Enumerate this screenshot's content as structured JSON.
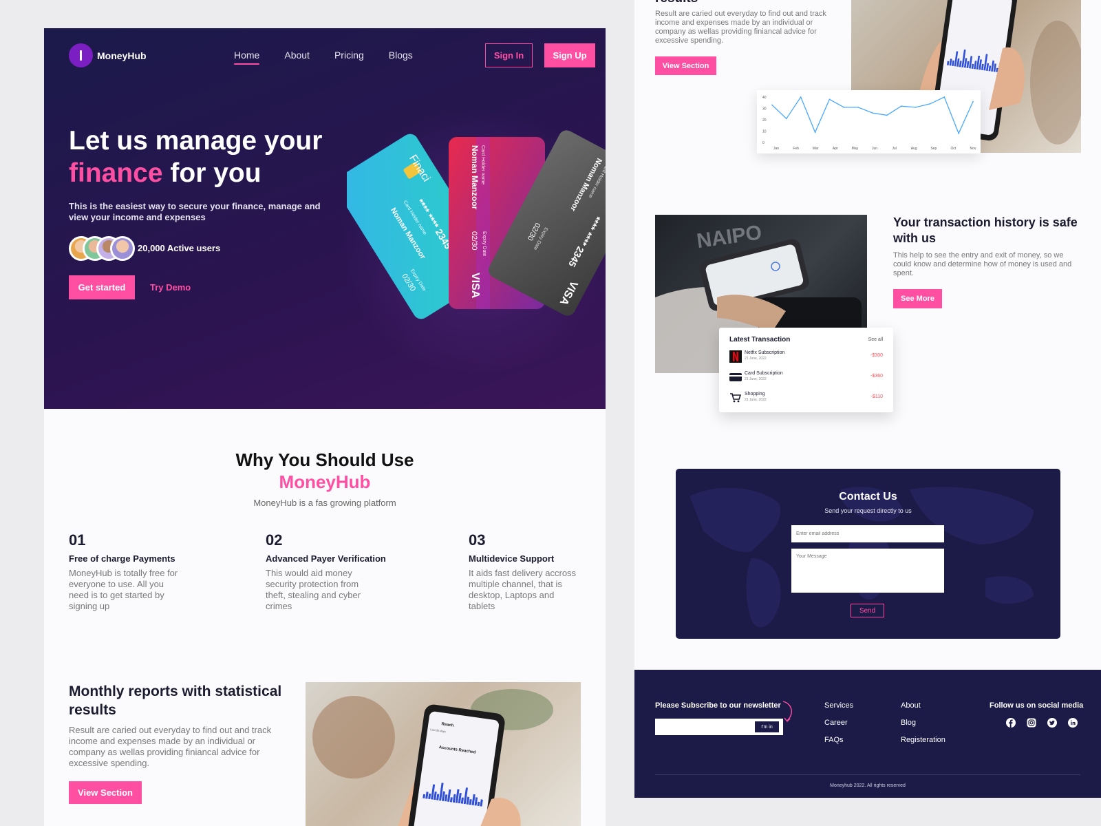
{
  "nav": {
    "logo_text": "MoneyHub",
    "links": [
      "Home",
      "About",
      "Pricing",
      "Blogs"
    ],
    "sign_in": "Sign In",
    "sign_up": "Sign Up"
  },
  "hero": {
    "title_line1": "Let us manage your",
    "title_pink": "finance",
    "title_rest": " for you",
    "subtitle": "This is the easiest way to secure your finance, manage and view your income and expenses",
    "active_users": "20,000 Active users",
    "cta": "Get started",
    "demo": "Try Demo"
  },
  "cards": [
    {
      "holder_label": "Card Holder name",
      "holder": "Noman Manzoor",
      "number": "**** **** 2345",
      "expiry_label": "Expiry Date",
      "expiry": "02/30",
      "brand": "VISA",
      "bank": "Finaci"
    },
    {
      "holder_label": "Card Holder name",
      "holder": "Noman Manzoor",
      "expiry_label": "Expiry Date",
      "expiry": "02/30",
      "brand": "VISA"
    },
    {
      "holder_label": "Card Holder name",
      "holder": "Noman Manzoor",
      "number": "**** **** 2345",
      "expiry_label": "Expiry Date",
      "expiry": "02/30",
      "brand": "VISA"
    }
  ],
  "why": {
    "title": "Why You Should Use",
    "brand": "MoneyHub",
    "subtitle": "MoneyHub is  a fas growing platform",
    "features": [
      {
        "num": "01",
        "title": "Free of charge Payments",
        "desc": "MoneyHub is totally free for everyone to use. All you need is to get started by signing up"
      },
      {
        "num": "02",
        "title": "Advanced Payer Verification",
        "desc": "This would aid money security protection from theft, stealing and cyber crimes"
      },
      {
        "num": "03",
        "title": "Multidevice Support",
        "desc": "It aids fast delivery accross multiple channel, that is desktop, Laptops and tablets"
      }
    ]
  },
  "reports": {
    "title": "Monthly reports with statistical results",
    "desc": "Result are caried out everyday to find out and track income and expenses made by an individual or company as wellas providing finiancal advice for excessive spending.",
    "button": "View Section",
    "phone_title": "Reach",
    "phone_sub": "Accounts Reached",
    "phone_filter": "Last 30 days"
  },
  "right_reports": {
    "title_cut": "results",
    "desc": "Result are caried out everyday to find out and track income and expenses made by an individual or company as wellas providing finiancal advice for excessive spending.",
    "button": "View Section"
  },
  "chart_data": {
    "type": "line",
    "categories": [
      "Jan",
      "Feb",
      "Mar",
      "Apr",
      "May",
      "Jun",
      "Jul",
      "Aug",
      "Sep",
      "Oct",
      "Nov"
    ],
    "values": [
      33,
      21,
      40,
      9,
      38,
      31,
      31,
      26,
      24,
      32,
      31,
      34,
      40,
      8,
      36
    ],
    "x_points": 15,
    "yticks": [
      "40",
      "30",
      "20",
      "10",
      "0"
    ],
    "ylim": [
      0,
      40
    ],
    "color": "#4aa8ff"
  },
  "safe": {
    "title": "Your transaction history is safe with us",
    "desc": "This help to see the entry and exit of money, so we could know and determine how of money is used and spent.",
    "button": "See More",
    "photo_caption": "NAIPO"
  },
  "transactions": {
    "title": "Latest Transaction",
    "see_all": "See all",
    "items": [
      {
        "name": "Netfix Subscription",
        "date": "21 June, 2022",
        "amount": "-$300",
        "icon": "netflix-icon"
      },
      {
        "name": "Card Subscription",
        "date": "21 June, 2022",
        "amount": "-$360",
        "icon": "card-icon"
      },
      {
        "name": "Shopping",
        "date": "21 June, 2022",
        "amount": "-$110",
        "icon": "cart-icon"
      }
    ]
  },
  "contact": {
    "title": "Contact Us",
    "subtitle": "Send your request directly to us",
    "email_placeholder": "Enter email address",
    "message_placeholder": "Your Message",
    "send": "Send"
  },
  "footer": {
    "newsletter_title": "Please Subscribe to our newsletter",
    "newsletter_button": "I'm in",
    "col1": [
      "Services",
      "Career",
      "FAQs"
    ],
    "col2": [
      "About",
      "Blog",
      "Registeration"
    ],
    "social_title": "Follow us on social media",
    "social": [
      "facebook-icon",
      "instagram-icon",
      "twitter-icon",
      "linkedin-icon"
    ],
    "copyright": "Moneyhub 2022. All rights reserved"
  },
  "colors": {
    "accent": "#ff4fa3",
    "navy": "#1c1a47",
    "hero_purple": "#2a1450"
  }
}
